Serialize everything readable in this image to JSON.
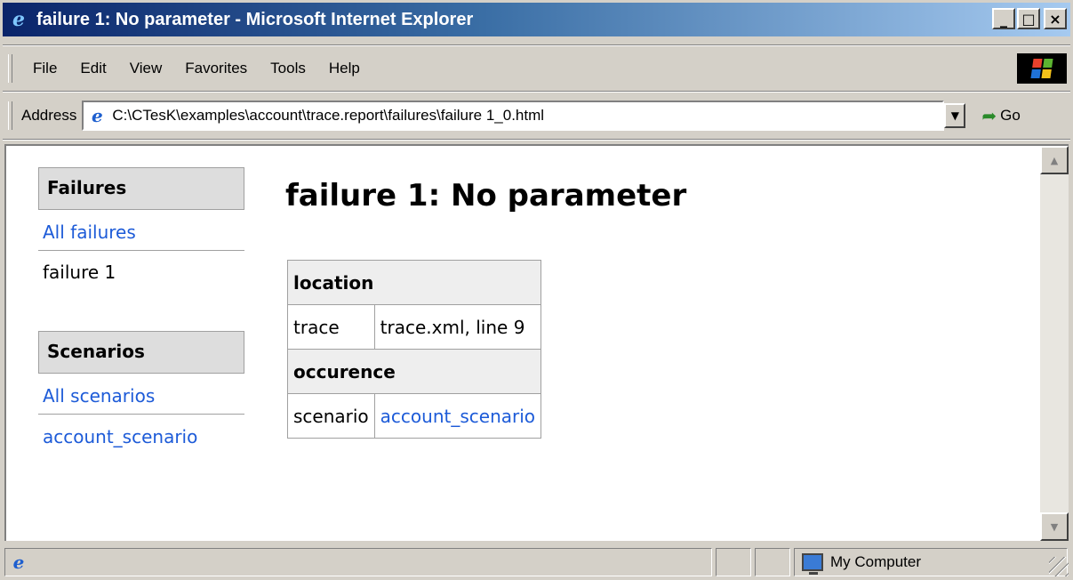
{
  "window": {
    "title": "failure 1: No parameter - Microsoft Internet Explorer",
    "caption_buttons": {
      "minimize": "_",
      "maximize": "□",
      "close": "×"
    }
  },
  "menu": {
    "items": [
      "File",
      "Edit",
      "View",
      "Favorites",
      "Tools",
      "Help"
    ]
  },
  "address": {
    "label": "Address",
    "value": "C:\\CTesK\\examples\\account\\trace.report\\failures\\failure 1_0.html",
    "go_label": "Go"
  },
  "sidebar": {
    "failures_heading": "Failures",
    "all_failures": "All failures",
    "current_failure": "failure 1",
    "scenarios_heading": "Scenarios",
    "all_scenarios": "All scenarios",
    "scenario_link": "account_scenario"
  },
  "page": {
    "title": "failure 1: No parameter",
    "table": {
      "location_header": "location",
      "trace_label": "trace",
      "trace_value": "trace.xml, line 9",
      "occurence_header": "occurence",
      "scenario_label": "scenario",
      "scenario_value": "account_scenario"
    }
  },
  "status": {
    "zone": "My Computer"
  },
  "icons": {
    "app": "ie-logo-icon",
    "address": "ie-page-icon",
    "go": "go-arrow-icon",
    "throbber": "windows-flag-icon",
    "zone": "my-computer-icon"
  },
  "colors": {
    "titlebar_start": "#0a246a",
    "titlebar_end": "#a6caf0",
    "link": "#1d5bd8",
    "chrome": "#d4d0c8"
  }
}
